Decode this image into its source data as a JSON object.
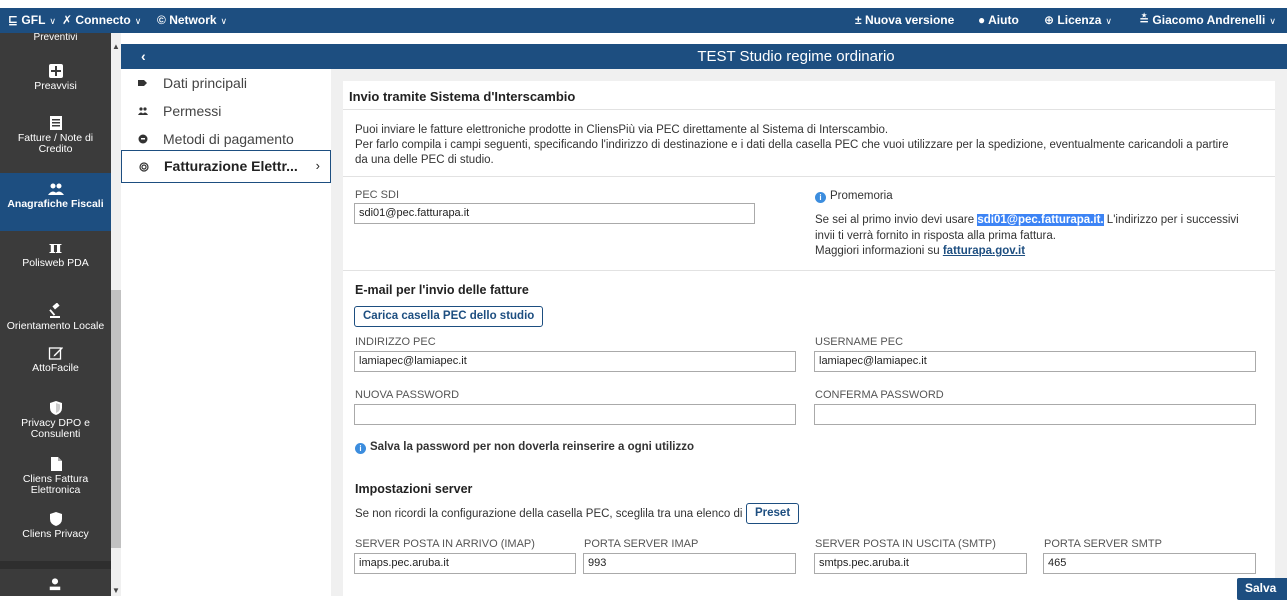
{
  "topbar": {
    "gfl": "GFL",
    "connecto": "Connecto",
    "network": "Network",
    "nuova_versione": "Nuova versione",
    "aiuto": "Aiuto",
    "licenza": "Licenza",
    "user": "Giacomo Andrenelli"
  },
  "sidebar": {
    "cut_item": "Preventivi",
    "items": [
      {
        "label": "Preavvisi",
        "icon": "plus-square-icon"
      },
      {
        "label": "Fatture / Note di Credito",
        "icon": "document-list-icon"
      },
      {
        "label": "Anagrafiche Fiscali",
        "icon": "users-icon"
      },
      {
        "label": "Polisweb PDA",
        "icon": "pi-icon"
      },
      {
        "label": "Orientamento Locale",
        "icon": "gavel-icon"
      },
      {
        "label": "AttoFacile",
        "icon": "edit-icon"
      },
      {
        "label": "Privacy DPO e Consulenti",
        "icon": "shield-icon"
      },
      {
        "label": "Cliens Fattura Elettronica",
        "icon": "file-icon"
      },
      {
        "label": "Cliens Privacy",
        "icon": "shield-filled-icon"
      }
    ]
  },
  "header": {
    "title": "TEST Studio regime ordinario",
    "back": "‹"
  },
  "submenu": {
    "items": [
      {
        "label": "Dati principali"
      },
      {
        "label": "Permessi"
      },
      {
        "label": "Metodi di pagamento"
      },
      {
        "label": "Fatturazione Elettr..."
      }
    ]
  },
  "panel": {
    "title": "Invio tramite Sistema d'Interscambio",
    "intro_line1": "Puoi inviare le fatture elettroniche prodotte in CliensPiù via PEC direttamente al Sistema di Interscambio.",
    "intro_line2": "Per farlo compila i campi seguenti, specificando l'indirizzo di destinazione e i dati della casella PEC che vuoi utilizzare per la spedizione, eventualmente caricandoli a partire",
    "intro_line3": "da una delle PEC di studio.",
    "pec_sdi_label": "PEC SDI",
    "pec_sdi_value": "sdi01@pec.fatturapa.it",
    "promemoria_title": "Promemoria",
    "prom_line1_pre": "Se sei al primo invio devi usare ",
    "prom_line1_hl": "sdi01@pec.fatturapa.it.",
    "prom_line1_post": " L'indirizzo per i successivi",
    "prom_line2": "invii ti verrà fornito in risposta alla prima fattura.",
    "prom_line3_pre": "Maggiori informazioni su ",
    "prom_line3_link": "fatturapa.gov.it",
    "email_section_title": "E-mail per l'invio delle fatture",
    "load_pec_button": "Carica casella PEC dello studio",
    "indirizzo_pec_label": "INDIRIZZO PEC",
    "indirizzo_pec_value": "lamiapec@lamiapec.it",
    "username_pec_label": "USERNAME PEC",
    "username_pec_value": "lamiapec@lamiapec.it",
    "nuova_password_label": "NUOVA PASSWORD",
    "nuova_password_value": "",
    "conferma_password_label": "CONFERMA PASSWORD",
    "conferma_password_value": "",
    "save_password_note": "Salva la password per non doverla reinserire a ogni utilizzo",
    "server_section_title": "Impostazioni server",
    "server_hint": "Se non ricordi la configurazione della casella PEC, sceglila tra una elenco di",
    "preset_button": "Preset",
    "imap_label": "SERVER POSTA IN ARRIVO (IMAP)",
    "imap_value": "imaps.pec.aruba.it",
    "imap_port_label": "PORTA SERVER IMAP",
    "imap_port_value": "993",
    "smtp_label": "SERVER POSTA IN USCITA (SMTP)",
    "smtp_value": "smtps.pec.aruba.it",
    "smtp_port_label": "PORTA SERVER SMTP",
    "smtp_port_value": "465"
  },
  "save_button": "Salva",
  "colors": {
    "brand": "#1d4e80",
    "sidebar": "#3b3b3b",
    "highlight": "#3d84f5"
  }
}
